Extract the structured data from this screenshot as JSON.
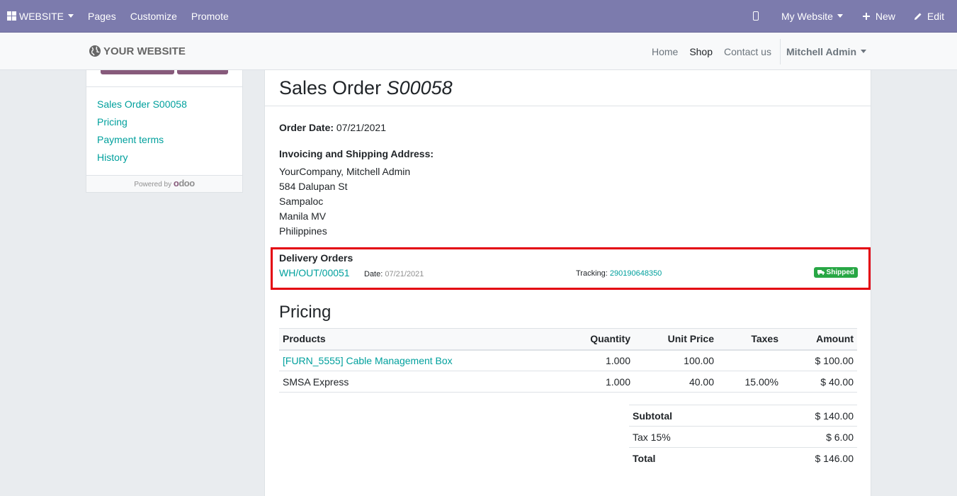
{
  "topbar": {
    "brand": "WEBSITE",
    "menu": [
      "Pages",
      "Customize",
      "Promote"
    ],
    "site_selector": "My Website",
    "new_label": "New",
    "edit_label": "Edit"
  },
  "header": {
    "logo": "YOUR WEBSITE",
    "nav": [
      "Home",
      "Shop",
      "Contact us"
    ],
    "user": "Mitchell Admin"
  },
  "sidebar": {
    "links": [
      "Sales Order S00058",
      "Pricing",
      "Payment terms",
      "History"
    ],
    "powered_by": "Powered by",
    "odoo_logo": "odoo"
  },
  "order": {
    "title_prefix": "Sales Order",
    "title_ref": "S00058",
    "date_label": "Order Date:",
    "date_value": "07/21/2021",
    "address_label": "Invoicing and Shipping Address:",
    "address_lines": [
      "YourCompany, Mitchell Admin",
      "584 Dalupan St",
      "Sampaloc",
      "Manila MV",
      "Philippines"
    ]
  },
  "delivery": {
    "label": "Delivery Orders",
    "ref": "WH/OUT/00051",
    "date_label": "Date:",
    "date_value": "07/21/2021",
    "tracking_label": "Tracking:",
    "tracking_value": "290190648350",
    "status": "Shipped",
    "status_color": "#28a745",
    "highlight_color": "#e3000f"
  },
  "pricing": {
    "title": "Pricing",
    "headers": [
      "Products",
      "Quantity",
      "Unit Price",
      "Taxes",
      "Amount"
    ],
    "rows": [
      {
        "product": "[FURN_5555] Cable Management Box",
        "qty": "1.000",
        "price": "100.00",
        "taxes": "",
        "amount": "$ 100.00"
      },
      {
        "product": "SMSA Express",
        "qty": "1.000",
        "price": "40.00",
        "taxes": "15.00%",
        "amount": "$ 40.00"
      }
    ],
    "totals": {
      "subtotal_label": "Subtotal",
      "subtotal": "$ 140.00",
      "tax_label": "Tax 15%",
      "tax": "$ 6.00",
      "total_label": "Total",
      "total": "$ 146.00"
    }
  },
  "colors": {
    "topbar": "#7c7bad",
    "link": "#00a09d",
    "odoo_purple": "#875a7b"
  }
}
